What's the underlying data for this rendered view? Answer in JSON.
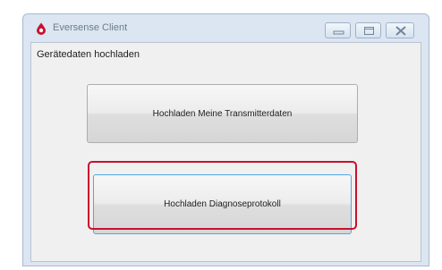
{
  "window": {
    "title": "Eversense Client",
    "app_icon": "eversense-drop-icon",
    "controls": {
      "minimize_icon": "minimize-icon",
      "maximize_icon": "maximize-icon",
      "close_icon": "close-icon"
    }
  },
  "content": {
    "section_label": "Gerätedaten hochladen",
    "upload_transmitter_label": "Hochladen Meine Transmitterdaten",
    "upload_diagnostics_label": "Hochladen Diagnoseprotokoll"
  },
  "colors": {
    "highlight": "#c8102e",
    "app_icon": "#c8102e",
    "focus_border": "#4fa6e2"
  }
}
